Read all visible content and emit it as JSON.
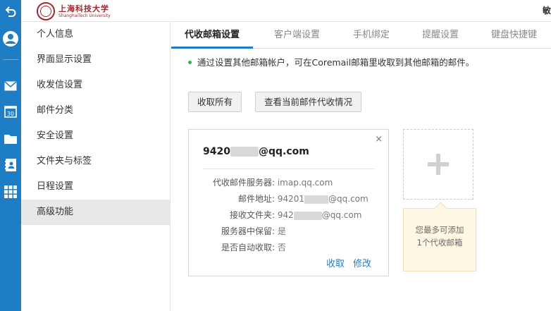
{
  "header": {
    "logo_cn": "上海科技大学",
    "logo_en": "ShanghaiTech University",
    "corner_text": "敏"
  },
  "rail": {
    "icons": [
      "back-icon",
      "avatar-icon",
      "mail-icon",
      "calendar-icon",
      "folder-icon",
      "contacts-icon",
      "apps-grid-icon"
    ],
    "calendar_day": "30"
  },
  "nav": {
    "items": [
      "个人信息",
      "界面显示设置",
      "收发信设置",
      "邮件分类",
      "安全设置",
      "文件夹与标签",
      "日程设置",
      "高级功能"
    ],
    "active": "高级功能"
  },
  "tabs": [
    "代收邮箱设置",
    "客户端设置",
    "手机绑定",
    "提醒设置",
    "键盘快捷键"
  ],
  "info": "通过设置其他邮箱帐户，可在Coremail邮箱里收取到其他邮箱的邮件。",
  "buttons": {
    "fetch_all": "收取所有",
    "view_status": "查看当前邮件代收情况"
  },
  "account": {
    "email_prefix": "9420",
    "email_suffix": "@qq.com",
    "rows": [
      {
        "label": "代收邮件服务器:",
        "value_pre": "imap.qq.com",
        "value_post": ""
      },
      {
        "label": "邮件地址:",
        "value_pre": "94201",
        "value_post": "@qq.com"
      },
      {
        "label": "接收文件夹:",
        "value_pre": "942",
        "value_post": "@qq.com"
      },
      {
        "label": "服务器中保留:",
        "value_pre": "是",
        "value_post": ""
      },
      {
        "label": "是否自动收取:",
        "value_pre": "否",
        "value_post": ""
      }
    ],
    "fetch_label": "收取",
    "edit_label": "修改",
    "close_symbol": "×"
  },
  "add_tip": {
    "line1": "您最多可添加",
    "line2": "1个代收邮箱",
    "plus": "+"
  },
  "colors": {
    "accent": "#1e7dc5",
    "brand": "#a4262c",
    "info_dot": "#3cb043"
  }
}
